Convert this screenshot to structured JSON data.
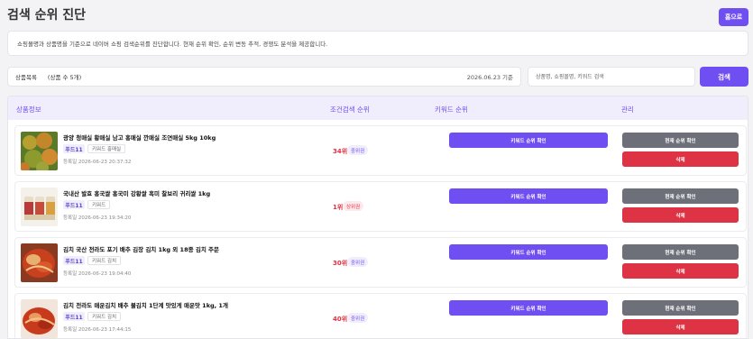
{
  "header": {
    "title": "검색 순위 진단",
    "home_label": "홈으로"
  },
  "description": "쇼핑몰명과 상품명을 기준으로 네이버 쇼핑 검색순위를 진단합니다. 현재 순위 확인, 순위 변동 추적, 경쟁도 분석을 제공합니다.",
  "filter": {
    "list_label": "상품목록",
    "count_label": "(상품 수 5개)",
    "date_label": "2026.06.23 기준",
    "search_placeholder": "상품명, 쇼핑몰명, 키워드 검색",
    "search_button": "검색"
  },
  "table": {
    "columns": [
      "상품정보",
      "조건검색 순위",
      "키워드 순위",
      "관리"
    ],
    "kw_button_label": "키워드 순위 확인",
    "current_button_label": "현재 순위 확인",
    "delete_button_label": "삭제",
    "rows": [
      {
        "name": "광양 청매실 황매실 남고 홍매실 깐매실 조연매실 5kg 10kg",
        "store": "푸드11",
        "keyword": "키워드 홍매실",
        "date": "등록일 2026-06-23 20:37:32",
        "rank": "34위",
        "trend": "중위권",
        "image": "plum"
      },
      {
        "name": "국내산 발효 홍국쌀 홍국미 강황쌀 흑미 찰보리 귀리쌀 1kg",
        "store": "푸드11",
        "keyword": "키워드",
        "date": "등록일 2026-06-23 19:34:20",
        "rank": "1위",
        "trend": "상위권",
        "image": "rice"
      },
      {
        "name": "김치 국산 전라도 포기 배추 김장 김치 1kg 외 18종 김치 주문",
        "store": "푸드11",
        "keyword": "키워드 김치",
        "date": "등록일 2026-06-23 19:04:40",
        "rank": "30위",
        "trend": "중위권",
        "image": "kimchi"
      },
      {
        "name": "김치 전라도 매운김치 배추 불김치 1단계 맛있게 매운맛 1kg, 1개",
        "store": "푸드11",
        "keyword": "키워드 김치",
        "date": "등록일 2026-06-23 17:44:15",
        "rank": "40위",
        "trend": "중위권",
        "image": "kimchi2"
      }
    ]
  }
}
